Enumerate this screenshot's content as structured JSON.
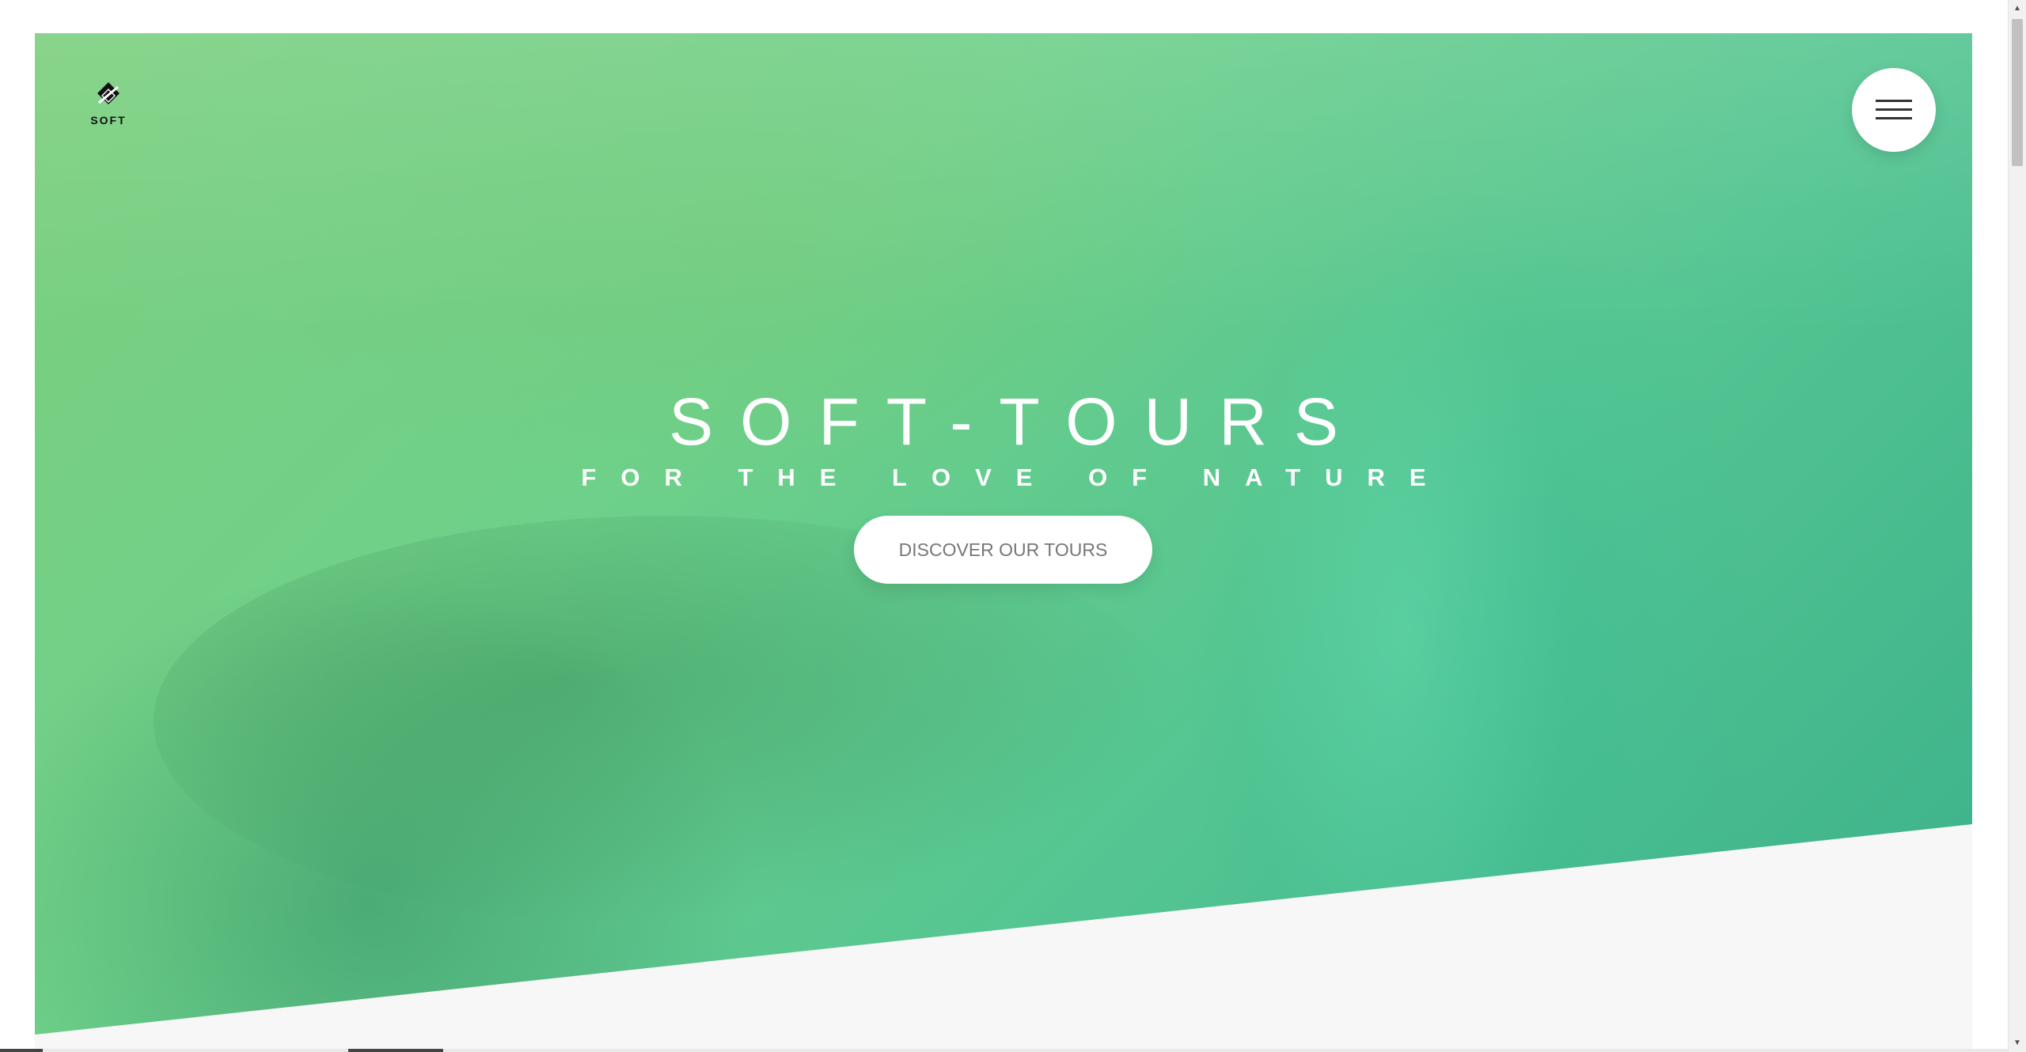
{
  "brand": {
    "logo_text": "SOFT",
    "logo_icon": "diamond-logo-icon"
  },
  "navigation": {
    "menu_icon": "hamburger-menu-icon"
  },
  "hero": {
    "title": "SOFT-TOURS",
    "subtitle": "FOR THE LOVE OF NATURE",
    "cta_label": "DISCOVER OUR TOURS",
    "background_colors": [
      "#7ccf7e",
      "#54c592",
      "#3bb08a"
    ]
  },
  "colors": {
    "accent_green": "#55c593",
    "section_background": "#f7f7f7",
    "button_text": "#777777"
  },
  "scrollbar": {
    "up_icon": "scroll-up-arrow-icon",
    "down_icon": "scroll-down-arrow-icon"
  }
}
